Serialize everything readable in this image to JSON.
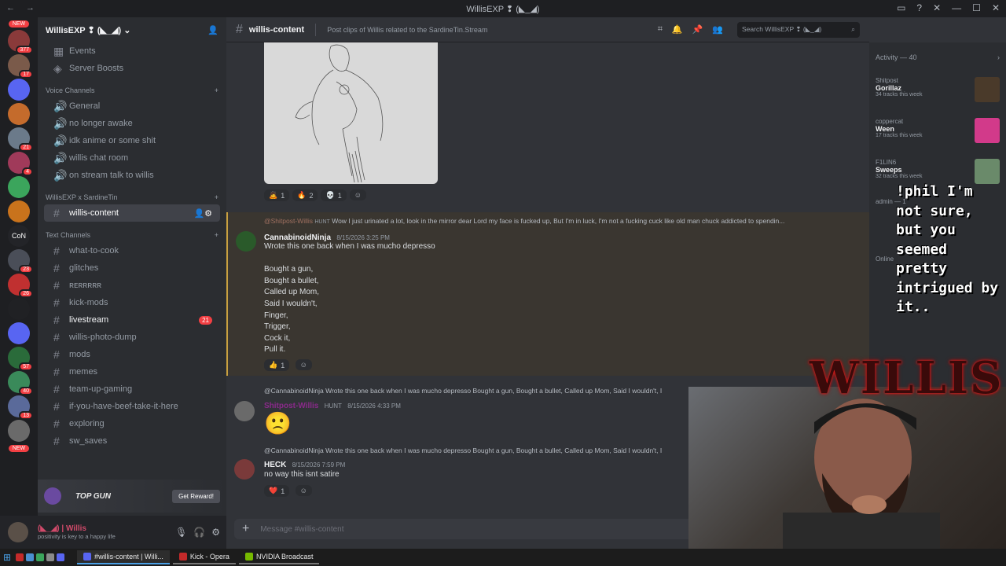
{
  "window": {
    "title": "WillisEXP ❢ (◣_◢)"
  },
  "guilds": [
    {
      "label": "",
      "color": "#8a3a3a",
      "badge": "377"
    },
    {
      "label": "",
      "color": "#7a5a4a",
      "badge": "17"
    },
    {
      "label": "",
      "color": "#5865f2",
      "badge": ""
    },
    {
      "label": "",
      "color": "#c46b2c",
      "badge": ""
    },
    {
      "label": "",
      "color": "#6b7a8a",
      "badge": "21"
    },
    {
      "label": "",
      "color": "#a03a5a",
      "badge": "4"
    },
    {
      "label": "",
      "color": "#3ba55c",
      "badge": ""
    },
    {
      "label": "",
      "color": "#c9731c",
      "badge": ""
    },
    {
      "label": "CoN",
      "color": "#232428",
      "badge": ""
    },
    {
      "label": "",
      "color": "#4a4e58",
      "badge": "23"
    },
    {
      "label": "",
      "color": "#c03030",
      "badge": "26"
    },
    {
      "label": "",
      "color": "#202124",
      "badge": ""
    },
    {
      "label": "",
      "color": "#5865f2",
      "badge": ""
    },
    {
      "label": "",
      "color": "#2a6b3a",
      "badge": "57"
    },
    {
      "label": "",
      "color": "#3a8a5a",
      "badge": "40"
    },
    {
      "label": "",
      "color": "#5a6a9a",
      "badge": "13"
    },
    {
      "label": "",
      "color": "#6a6a6a",
      "badge": ""
    }
  ],
  "guild_new_top": "NEW",
  "guild_new_bottom": "NEW",
  "server": {
    "name": "WillisEXP ❢ (◣_◢)"
  },
  "sidebar": {
    "top_items": [
      "Events",
      "Server Boosts"
    ],
    "voice_category": "Voice Channels",
    "voice_channels": [
      "General",
      "no longer awake",
      "idk anime or some shit",
      "willis chat room",
      "on stream talk to willis"
    ],
    "collab_category": "WillisEXP x SardineTin",
    "collab_channels": [
      "willis-content"
    ],
    "text_category": "Text Channels",
    "text_channels": [
      {
        "name": "what-to-cook",
        "badge": ""
      },
      {
        "name": "glitches",
        "badge": ""
      },
      {
        "name": "ʀᴇʀʀʀʀʀ",
        "badge": ""
      },
      {
        "name": "kick-mods",
        "badge": ""
      },
      {
        "name": "livestream",
        "badge": "21"
      },
      {
        "name": "willis-photo-dump",
        "badge": ""
      },
      {
        "name": "mods",
        "badge": ""
      },
      {
        "name": "memes",
        "badge": ""
      },
      {
        "name": "team-up-gaming",
        "badge": ""
      },
      {
        "name": "if-you-have-beef-take-it-here",
        "badge": ""
      },
      {
        "name": "exploring",
        "badge": ""
      },
      {
        "name": "sw_saves",
        "badge": ""
      }
    ]
  },
  "promo": {
    "logo": "TOP GUN",
    "button": "Get Reward!"
  },
  "user": {
    "name": "(◣_◢) | Willis",
    "status": "positivity is key to a happy life"
  },
  "channel": {
    "name": "willis-content",
    "topic": "Post clips of Willis related to the SardineTin.Stream"
  },
  "search": {
    "placeholder": "Search WillisEXP ❢ (◣_◢)"
  },
  "messages": {
    "m0_reactions": [
      {
        "emoji": "🙇",
        "count": "1"
      },
      {
        "emoji": "🔥",
        "count": "2"
      },
      {
        "emoji": "💀",
        "count": "1"
      }
    ],
    "m1": {
      "reply_user": "@Shitpost-Willis",
      "reply_tag": "HUNT",
      "reply_text": "Wow I just urinated a lot, look in the mirror dear Lord my face is fucked up, But I'm in luck, I'm not a fucking cuck like old man chuck addicted to spendin...",
      "author": "CannabinoidNinja",
      "time": "8/15/2026 3:25 PM",
      "lines": [
        "Wrote this one back when I was mucho depresso",
        "",
        "Bought a gun,",
        "Bought a bullet,",
        "Called up Mom,",
        "Said I wouldn't,",
        "Finger,",
        "Trigger,",
        "Cock it,",
        "Pull it."
      ],
      "reaction": {
        "emoji": "👍",
        "count": "1"
      }
    },
    "m2": {
      "reply_user": "@CannabinoidNinja",
      "reply_text": "Wrote this one back when I was mucho depresso  Bought a gun, Bought a bullet, Called up Mom, Said I wouldn't, I",
      "author": "Shitpost-Willis",
      "tag": "HUNT",
      "time": "8/15/2026 4:33 PM",
      "emoji": "🙁"
    },
    "m3": {
      "reply_user": "@CannabinoidNinja",
      "reply_text": "Wrote this one back when I was mucho depresso  Bought a gun, Bought a bullet, Called up Mom, Said I wouldn't, I",
      "author": "HECK",
      "time": "8/15/2026 7:59 PM",
      "text": "no way this isnt satire",
      "reaction": {
        "emoji": "❤️",
        "count": "1"
      }
    }
  },
  "composer": {
    "placeholder": "Message #willis-content"
  },
  "activity": {
    "header": "Activity — 40",
    "items": [
      {
        "user": "Shitpost",
        "title": "Gorillaz",
        "sub": "34 tracks this week",
        "color": "#4a3a2a"
      },
      {
        "user": "coppercat",
        "title": "Ween",
        "sub": "17 tracks this week",
        "color": "#d23a8a"
      },
      {
        "user": "F1LIN6",
        "title": "Sweeps",
        "sub": "32 tracks this week",
        "color": "#6a8a6a"
      }
    ],
    "admin_label": "admin — 1",
    "online_label": "Online"
  },
  "overlay": {
    "chat_text": "!phil I'm not sure, but you seemed pretty intrigued by it..",
    "brand": "WILLIS"
  },
  "taskbar": [
    {
      "label": "#willis-content | Willi...",
      "color": "#5865f2"
    },
    {
      "label": "Kick - Opera",
      "color": "#c42a2a"
    },
    {
      "label": "NVIDIA Broadcast",
      "color": "#76b900"
    }
  ]
}
